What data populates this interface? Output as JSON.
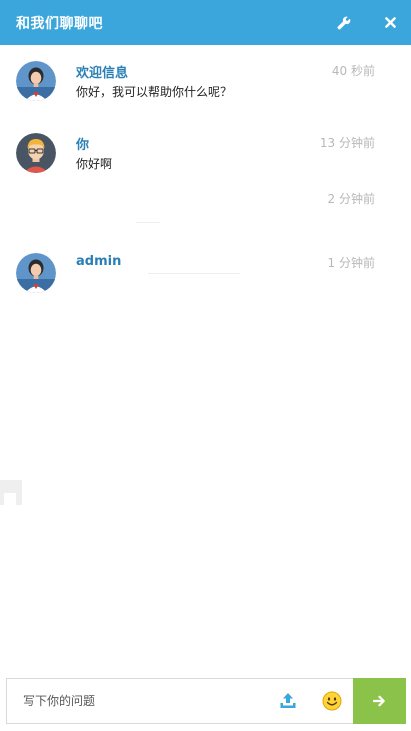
{
  "header": {
    "title": "和我们聊聊吧",
    "settings_icon": "wrench-icon",
    "close_icon": "close-icon"
  },
  "messages": [
    {
      "name": "欢迎信息",
      "time": "40 秒前",
      "text": "你好，我可以帮助你什么呢？",
      "avatar": "agent-avatar"
    },
    {
      "name": "你",
      "time": "13 分钟前",
      "text": "你好啊",
      "avatar": "user-avatar"
    },
    {
      "name": "",
      "time": "2 分钟前",
      "text": "",
      "avatar": ""
    },
    {
      "name": "admin",
      "time": "1 分钟前",
      "text": "",
      "avatar": "agent-avatar"
    }
  ],
  "composer": {
    "placeholder": "写下你的问题",
    "upload_icon": "upload-icon",
    "emoji_icon": "smiley-icon",
    "send_icon": "arrow-right-icon"
  },
  "colors": {
    "header": "#3aa6dc",
    "name": "#2a7fb5",
    "send": "#8bc34a"
  }
}
